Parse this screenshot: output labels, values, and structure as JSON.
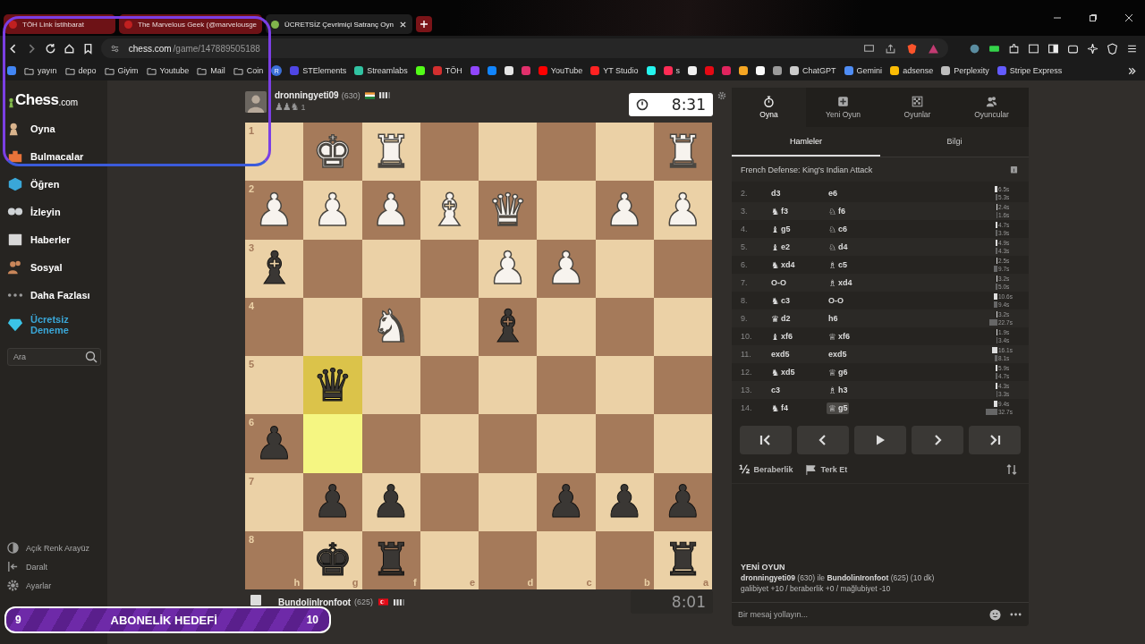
{
  "browser": {
    "tabs": [
      {
        "title": "TÖH Link İstihbarat",
        "selected": false
      },
      {
        "title": "The Marvelous Geek (@marvelousge",
        "selected": false
      },
      {
        "title": "ÜCRETSİZ Çevrimiçi Satranç Oyn",
        "selected": true
      }
    ],
    "url_host": "chess.com",
    "url_path": "/game/147889505188",
    "bookmarks": [
      {
        "kind": "site",
        "color": "#4285f4"
      },
      {
        "kind": "folder",
        "label": "yayın"
      },
      {
        "kind": "folder",
        "label": "depo"
      },
      {
        "kind": "folder",
        "label": "Giyim"
      },
      {
        "kind": "folder",
        "label": "Youtube"
      },
      {
        "kind": "folder",
        "label": "Mail"
      },
      {
        "kind": "folder",
        "label": "Coin"
      },
      {
        "kind": "badge",
        "label": "R",
        "color": "#3b6fd8"
      },
      {
        "kind": "site",
        "label": "STElements",
        "color": "#4f46e5"
      },
      {
        "kind": "site",
        "label": "Streamlabs",
        "color": "#31c3a2"
      },
      {
        "kind": "site",
        "color": "#53fc18"
      },
      {
        "kind": "site",
        "label": "TÖH",
        "color": "#d32f2f"
      },
      {
        "kind": "site",
        "color": "#9146ff"
      },
      {
        "kind": "site",
        "color": "#1185fe"
      },
      {
        "kind": "site",
        "color": "#e5e5e5"
      },
      {
        "kind": "site",
        "color": "#e1306c"
      },
      {
        "kind": "site",
        "label": "YouTube",
        "color": "#ff0000"
      },
      {
        "kind": "site",
        "label": "YT Studio",
        "color": "#ff2222"
      },
      {
        "kind": "site",
        "color": "#25f4ee"
      },
      {
        "kind": "site",
        "label": "s",
        "color": "#fe2c55"
      },
      {
        "kind": "site",
        "color": "#f0f0f0"
      },
      {
        "kind": "site",
        "color": "#e50914"
      },
      {
        "kind": "site",
        "color": "#e0245e"
      },
      {
        "kind": "site",
        "color": "#f5a623"
      },
      {
        "kind": "site",
        "color": "#fafafa"
      },
      {
        "kind": "site",
        "color": "#9a9a9a"
      },
      {
        "kind": "site",
        "label": "ChatGPT",
        "color": "#cccccc"
      },
      {
        "kind": "site",
        "label": "Gemini",
        "color": "#4f8df5"
      },
      {
        "kind": "site",
        "label": "adsense",
        "color": "#fbbc04"
      },
      {
        "kind": "site",
        "label": "Perplexity",
        "color": "#bdbdbd"
      },
      {
        "kind": "site",
        "label": "Stripe Express",
        "color": "#635bff"
      }
    ]
  },
  "sidebar": {
    "logo_main": "Chess",
    "logo_suffix": ".com",
    "items": [
      {
        "kind": "play",
        "label": "Oyna"
      },
      {
        "kind": "puzzles",
        "label": "Bulmacalar"
      },
      {
        "kind": "learn",
        "label": "Öğren"
      },
      {
        "kind": "watch",
        "label": "İzleyin"
      },
      {
        "kind": "news",
        "label": "Haberler"
      },
      {
        "kind": "social",
        "label": "Sosyal"
      },
      {
        "kind": "more",
        "label": "Daha Fazlası"
      },
      {
        "kind": "trial",
        "label": "Ücretsiz Deneme"
      }
    ],
    "search": {
      "placeholder": "Ara"
    },
    "footer": [
      {
        "kind": "theme",
        "label": "Açık Renk Arayüz"
      },
      {
        "kind": "collapse",
        "label": "Daralt"
      },
      {
        "kind": "settings",
        "label": "Ayarlar"
      }
    ]
  },
  "top_player": {
    "name": "dronningyeti09",
    "rating": "(630)",
    "captured": "♟♟♞",
    "advantage": "1",
    "clock": "8:31",
    "active": true
  },
  "bottom_player": {
    "name": "BundolinIronfoot",
    "rating": "(625)",
    "clock": "8:01",
    "active": false
  },
  "board": {
    "files": [
      "h",
      "g",
      "f",
      "e",
      "d",
      "c",
      "b",
      "a"
    ],
    "ranks": [
      {
        "label": "1",
        "squares": [
          {
            "highlighted": false
          },
          {
            "piece": "♚",
            "color": "#f7f3ee",
            "highlighted": false
          },
          {
            "piece": "♜",
            "color": "#f7f3ee",
            "highlighted": false
          },
          {
            "highlighted": false
          },
          {
            "highlighted": false
          },
          {
            "highlighted": false
          },
          {
            "highlighted": false
          },
          {
            "piece": "♜",
            "color": "#f7f3ee",
            "highlighted": false
          }
        ]
      },
      {
        "label": "2",
        "squares": [
          {
            "piece": "♟",
            "color": "#f7f3ee",
            "highlighted": false
          },
          {
            "piece": "♟",
            "color": "#f7f3ee",
            "highlighted": false
          },
          {
            "piece": "♟",
            "color": "#f7f3ee",
            "highlighted": false
          },
          {
            "piece": "♝",
            "color": "#f7f3ee",
            "highlighted": false
          },
          {
            "piece": "♛",
            "color": "#f7f3ee",
            "highlighted": false
          },
          {
            "highlighted": false
          },
          {
            "piece": "♟",
            "color": "#f7f3ee",
            "highlighted": false
          },
          {
            "piece": "♟",
            "color": "#f7f3ee",
            "highlighted": false
          }
        ]
      },
      {
        "label": "3",
        "squares": [
          {
            "piece": "♝",
            "color": "#3a3734",
            "highlighted": false
          },
          {
            "highlighted": false
          },
          {
            "highlighted": false
          },
          {
            "highlighted": false
          },
          {
            "piece": "♟",
            "color": "#f7f3ee",
            "highlighted": false
          },
          {
            "piece": "♟",
            "color": "#f7f3ee",
            "highlighted": false
          },
          {
            "highlighted": false
          },
          {
            "highlighted": false
          }
        ]
      },
      {
        "label": "4",
        "squares": [
          {
            "highlighted": false
          },
          {
            "highlighted": false
          },
          {
            "piece": "♞",
            "color": "#f7f3ee",
            "highlighted": false
          },
          {
            "highlighted": false
          },
          {
            "piece": "♝",
            "color": "#3a3734",
            "highlighted": false
          },
          {
            "highlighted": false
          },
          {
            "highlighted": false
          },
          {
            "highlighted": false
          }
        ]
      },
      {
        "label": "5",
        "squares": [
          {
            "highlighted": false
          },
          {
            "piece": "♛",
            "color": "#3a3734",
            "highlighted": true
          },
          {
            "highlighted": false
          },
          {
            "highlighted": false
          },
          {
            "highlighted": false
          },
          {
            "highlighted": false
          },
          {
            "highlighted": false
          },
          {
            "highlighted": false
          }
        ]
      },
      {
        "label": "6",
        "squares": [
          {
            "piece": "♟",
            "color": "#3a3734",
            "highlighted": false
          },
          {
            "highlighted": true
          },
          {
            "highlighted": false
          },
          {
            "highlighted": false
          },
          {
            "highlighted": false
          },
          {
            "highlighted": false
          },
          {
            "highlighted": false
          },
          {
            "highlighted": false
          }
        ]
      },
      {
        "label": "7",
        "squares": [
          {
            "highlighted": false
          },
          {
            "piece": "♟",
            "color": "#3a3734",
            "highlighted": false
          },
          {
            "piece": "♟",
            "color": "#3a3734",
            "highlighted": false
          },
          {
            "highlighted": false
          },
          {
            "highlighted": false
          },
          {
            "piece": "♟",
            "color": "#3a3734",
            "highlighted": false
          },
          {
            "piece": "♟",
            "color": "#3a3734",
            "highlighted": false
          },
          {
            "piece": "♟",
            "color": "#3a3734",
            "highlighted": false
          }
        ]
      },
      {
        "label": "8",
        "squares": [
          {
            "highlighted": false
          },
          {
            "piece": "♚",
            "color": "#3a3734",
            "highlighted": false
          },
          {
            "piece": "♜",
            "color": "#3a3734",
            "highlighted": false
          },
          {
            "highlighted": false
          },
          {
            "highlighted": false
          },
          {
            "highlighted": false
          },
          {
            "highlighted": false
          },
          {
            "piece": "♜",
            "color": "#3a3734",
            "highlighted": false
          }
        ]
      }
    ]
  },
  "panel": {
    "top_tabs": [
      {
        "kind": "play",
        "label": "Oyna",
        "selected": true
      },
      {
        "kind": "new",
        "label": "Yeni Oyun",
        "selected": false
      },
      {
        "kind": "games",
        "label": "Oyunlar",
        "selected": false
      },
      {
        "kind": "players",
        "label": "Oyuncular",
        "selected": false
      }
    ],
    "sub_tabs": [
      {
        "label": "Hamleler",
        "selected": true
      },
      {
        "label": "Bilgi",
        "selected": false
      }
    ],
    "opening": "French Defense: King's Indian Attack",
    "moves": [
      {
        "number": "2.",
        "white": {
          "san": "d3",
          "selected": false,
          "time": "6.5s"
        },
        "black": {
          "san": "e6",
          "selected": false,
          "time": "5.3s"
        }
      },
      {
        "number": "3.",
        "white": {
          "piece": "♞",
          "san": "f3",
          "selected": false,
          "time": "2.4s"
        },
        "black": {
          "piece": "♘",
          "san": "f6",
          "selected": false,
          "time": "1.6s"
        }
      },
      {
        "number": "4.",
        "white": {
          "piece": "♝",
          "san": "g5",
          "selected": false,
          "time": "4.7s"
        },
        "black": {
          "piece": "♘",
          "san": "c6",
          "selected": false,
          "time": "3.9s"
        }
      },
      {
        "number": "5.",
        "white": {
          "piece": "♝",
          "san": "e2",
          "selected": false,
          "time": "4.9s"
        },
        "black": {
          "piece": "♘",
          "san": "d4",
          "selected": false,
          "time": "4.3s"
        }
      },
      {
        "number": "6.",
        "white": {
          "piece": "♞",
          "san": "xd4",
          "selected": false,
          "time": "2.5s"
        },
        "black": {
          "piece": "♗",
          "san": "c5",
          "selected": false,
          "time": "9.7s"
        }
      },
      {
        "number": "7.",
        "white": {
          "san": "O-O",
          "selected": false,
          "time": "3.2s"
        },
        "black": {
          "piece": "♗",
          "san": "xd4",
          "selected": false,
          "time": "5.0s"
        }
      },
      {
        "number": "8.",
        "white": {
          "piece": "♞",
          "san": "c3",
          "selected": false,
          "time": "10.6s"
        },
        "black": {
          "san": "O-O",
          "selected": false,
          "time": "9.4s"
        }
      },
      {
        "number": "9.",
        "white": {
          "piece": "♛",
          "san": "d2",
          "selected": false,
          "time": "3.2s"
        },
        "black": {
          "san": "h6",
          "selected": false,
          "time": "22.7s"
        }
      },
      {
        "number": "10.",
        "white": {
          "piece": "♝",
          "san": "xf6",
          "selected": false,
          "time": "1.9s"
        },
        "black": {
          "piece": "♕",
          "san": "xf6",
          "selected": false,
          "time": "3.4s"
        }
      },
      {
        "number": "11.",
        "white": {
          "san": "exd5",
          "selected": false,
          "time": "16.1s"
        },
        "black": {
          "san": "exd5",
          "selected": false,
          "time": "8.1s"
        }
      },
      {
        "number": "12.",
        "white": {
          "piece": "♞",
          "san": "xd5",
          "selected": false,
          "time": "5.9s"
        },
        "black": {
          "piece": "♕",
          "san": "g6",
          "selected": false,
          "time": "4.7s"
        }
      },
      {
        "number": "13.",
        "white": {
          "san": "c3",
          "selected": false,
          "time": "4.3s"
        },
        "black": {
          "piece": "♗",
          "san": "h3",
          "selected": false,
          "time": "3.3s"
        }
      },
      {
        "number": "14.",
        "white": {
          "piece": "♞",
          "san": "f4",
          "selected": false,
          "time": "9.4s"
        },
        "black": {
          "piece": "♕",
          "san": "g5",
          "selected": true,
          "time": "32.7s"
        }
      }
    ],
    "draw_symbol": "½",
    "draw_label": "Beraberlik",
    "resign_label": "Terk Et",
    "chat": {
      "heading": "YENİ OYUN",
      "line": "**dronningyeti09** (630) ile **BundolinIronfoot** (625) (10 dk)",
      "result_line": "galibiyet +10 / beraberlik +0 / mağlubiyet -10",
      "placeholder": "Bir mesaj yollayın..."
    }
  },
  "overlay": {
    "current": "9",
    "title": "ABONELİK HEDEFİ",
    "goal": "10"
  }
}
